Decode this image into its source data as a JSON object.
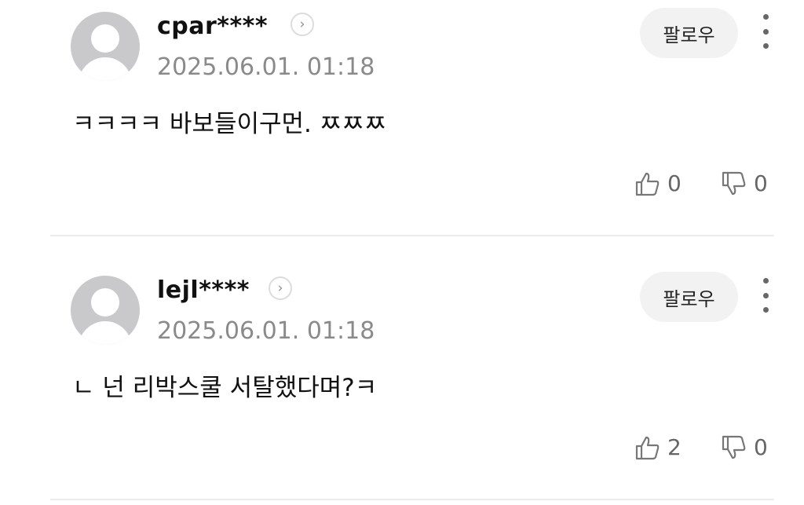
{
  "comments": [
    {
      "username": "cpar****",
      "timestamp": "2025.06.01. 01:18",
      "text": "ㅋㅋㅋㅋ 바보들이구먼. ㅉㅉㅉ",
      "follow_label": "팔로우",
      "likes": "0",
      "dislikes": "0",
      "profile_arrow_glyph": "›"
    },
    {
      "username": "lejl****",
      "timestamp": "2025.06.01. 01:18",
      "text": "ㄴ 넌 리박스쿨 서탈했다며?ㅋ",
      "follow_label": "팔로우",
      "likes": "2",
      "dislikes": "0",
      "profile_arrow_glyph": "›"
    }
  ],
  "icons": {
    "avatar": "default-avatar-icon",
    "profile_arrow": "chevron-right-icon",
    "more": "more-vertical-icon",
    "like": "thumbs-up-icon",
    "dislike": "thumbs-down-icon"
  },
  "colors": {
    "avatar_bg": "#c9c9cc",
    "timestamp": "#8a8a8a",
    "follow_bg": "#f2f2f2",
    "divider": "#ececec"
  }
}
